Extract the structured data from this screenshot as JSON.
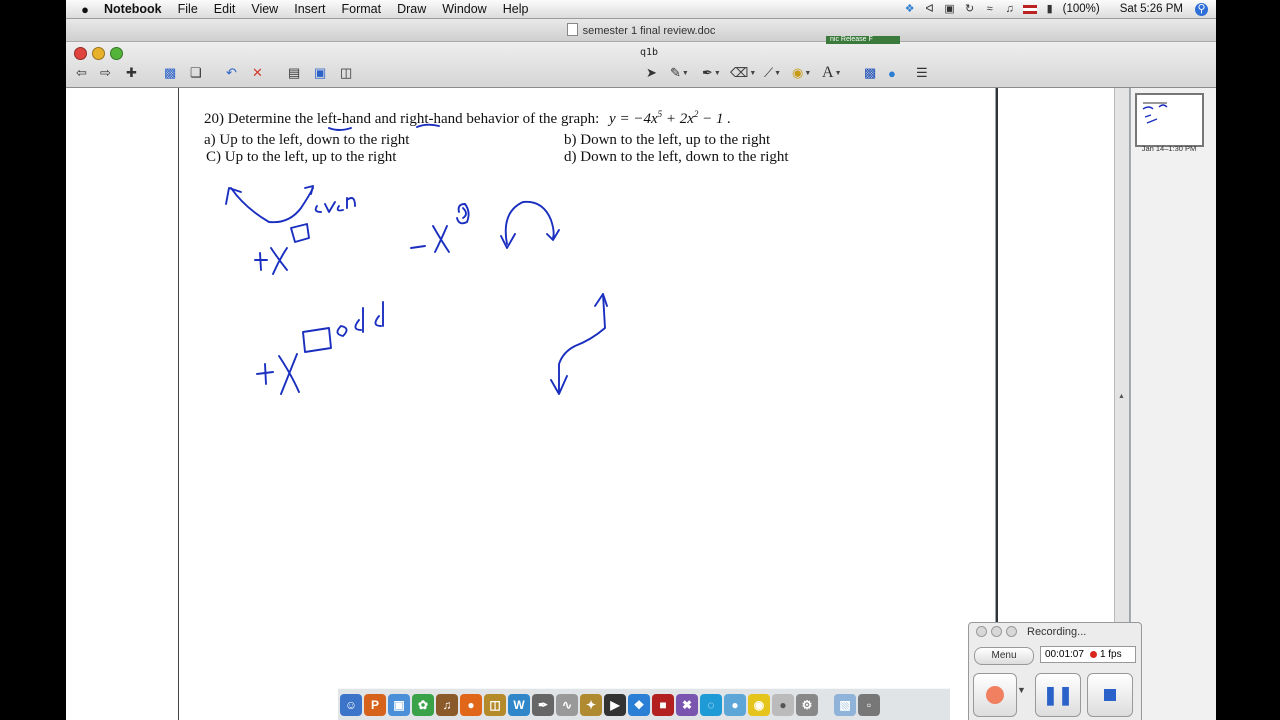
{
  "menubar": {
    "app": "Notebook",
    "items": [
      "File",
      "Edit",
      "View",
      "Insert",
      "Format",
      "Draw",
      "Window",
      "Help"
    ],
    "battery": "(100%)",
    "clock": "Sat 5:26 PM"
  },
  "window": {
    "title": "semester 1 final review.doc",
    "page_label": "q1b"
  },
  "toolbar": {
    "icons": [
      "back-page-icon",
      "forward-page-icon",
      "add-page-icon",
      "save-icon",
      "paste-icon",
      "undo-icon",
      "delete-icon",
      "screen-shade-icon",
      "full-screen-icon",
      "capture-icon",
      "select-arrow-icon",
      "pen-icon",
      "creative-pen-icon",
      "eraser-icon",
      "line-icon",
      "fill-icon",
      "text-icon",
      "properties-icon",
      "web-icon",
      "toolbar-options-icon"
    ]
  },
  "question": {
    "stem": "20) Determine the left-hand and right-hand behavior of the graph:",
    "equation_lhs": "y",
    "equation_rhs_a": "= −4x",
    "exp1": "5",
    "equation_rhs_b": " + 2x",
    "exp2": "2",
    "equation_rhs_c": " − 1 .",
    "options": {
      "a": "a)    Up to the left, down to the right",
      "b": "b) Down to the left, up to the right",
      "c": "C) Up to the left, up to the right",
      "d": "d) Down to the left, down to the right"
    }
  },
  "sidebar": {
    "thumb_label": "Jan 14–1:30 PM"
  },
  "recorder": {
    "title": "Recording...",
    "menu_label": "Menu",
    "time": "00:01:07",
    "fps": "1 fps"
  },
  "colors": {
    "ink": "#1a2fc0",
    "record_red": "#d9261c",
    "close_light": "#e0443e",
    "min_light": "#e8b12b",
    "zoom_light": "#53b43a"
  }
}
